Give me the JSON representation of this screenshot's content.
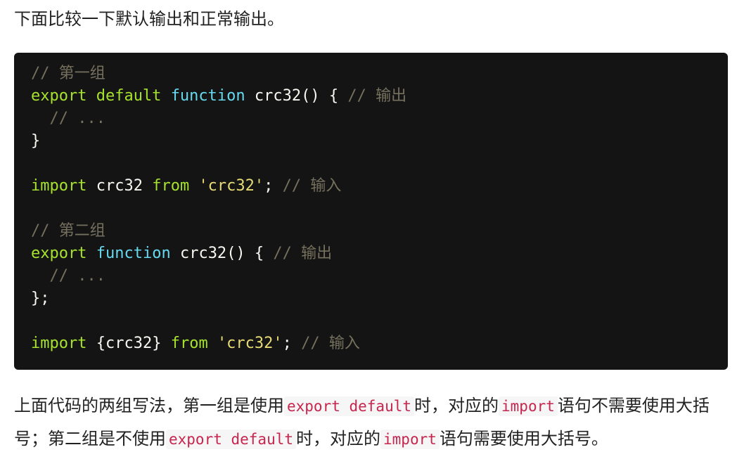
{
  "intro": "下面比较一下默认输出和正常输出。",
  "code": {
    "line1_comment": "// 第一组",
    "line2_kw": "export default",
    "line2_fn": "function",
    "line2_name": "crc32",
    "line2_punc": "() { ",
    "line2_comment": "// 输出",
    "line3_comment": "  // ...",
    "line4": "}",
    "line6_kw": "import",
    "line6_name": " crc32 ",
    "line6_from": "from",
    "line6_str": "'crc32'",
    "line6_semi": "; ",
    "line6_comment": "// 输入",
    "line8_comment": "// 第二组",
    "line9_kw": "export",
    "line9_fn": "function",
    "line9_name": "crc32",
    "line9_punc": "() { ",
    "line9_comment": "// 输出",
    "line10_comment": "  // ...",
    "line11": "};",
    "line13_kw": "import",
    "line13_name": " {crc32} ",
    "line13_from": "from",
    "line13_str": "'crc32'",
    "line13_semi": "; ",
    "line13_comment": "// 输入"
  },
  "body": {
    "t1": "上面代码的两组写法，第一组是使用",
    "c1": "export default",
    "t2": "时，对应的",
    "c2": "import",
    "t3": "语句不需要使用大括号；第二组是不使用",
    "c3": "export default",
    "t4": "时，对应的",
    "c4": "import",
    "t5": "语句需要使用大括号。"
  }
}
